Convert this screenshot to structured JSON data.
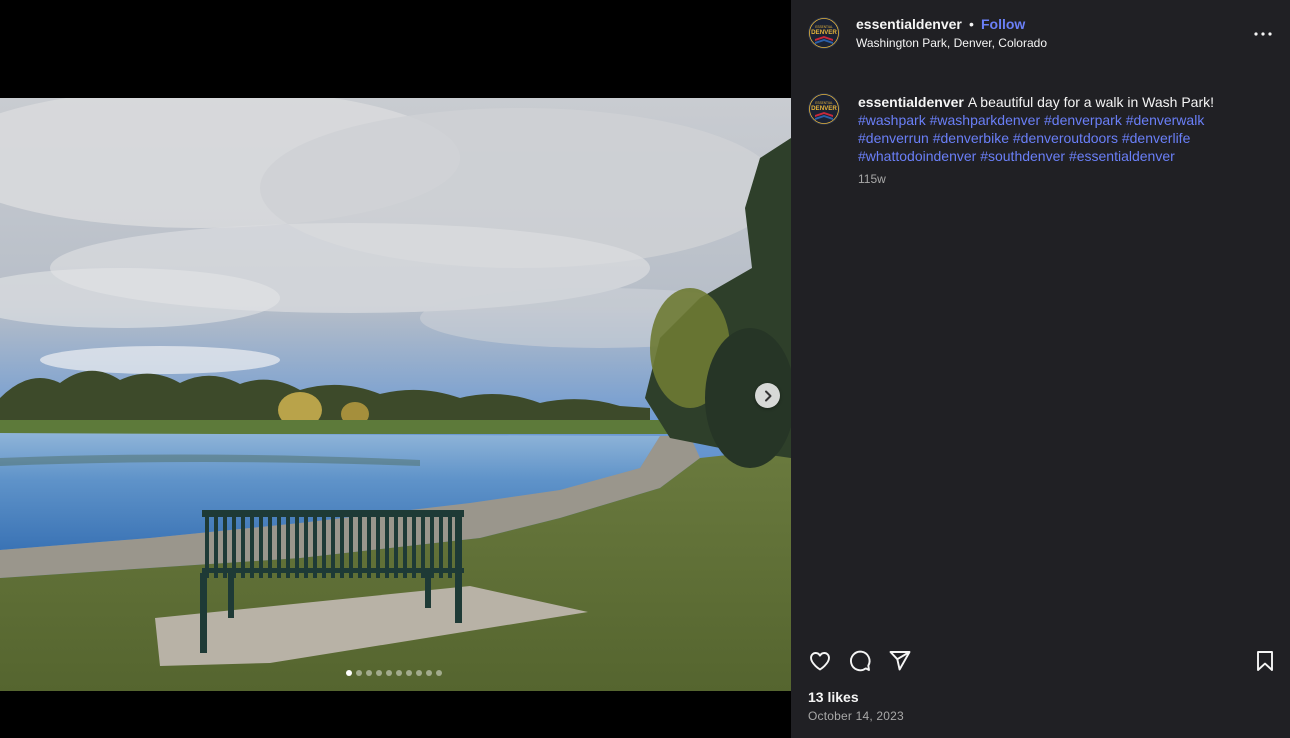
{
  "media": {
    "next_icon": "chevron-right-icon",
    "carousel_count": 10,
    "carousel_active_index": 0
  },
  "header": {
    "username": "essentialdenver",
    "separator": "•",
    "follow_label": "Follow",
    "location": "Washington Park, Denver, Colorado",
    "more_icon": "more-horizontal-icon"
  },
  "avatar": {
    "text_top": "ESSENTIAL",
    "text_main": "DENVER",
    "colors": {
      "ring": "#27324a",
      "gold": "#e6b43a",
      "red": "#c8283a",
      "blue": "#2b5fa8"
    }
  },
  "caption": {
    "username": "essentialdenver",
    "text": "A beautiful day for a walk in Wash Park!",
    "hashtags": [
      "#washpark",
      "#washparkdenver",
      "#denverpark",
      "#denverwalk",
      "#denverrun",
      "#denverbike",
      "#denveroutdoors",
      "#denverlife",
      "#whattodoindenver",
      "#southdenver",
      "#essentialdenver"
    ],
    "time": "115w"
  },
  "actions": {
    "like_icon": "heart-icon",
    "comment_icon": "comment-icon",
    "share_icon": "send-icon",
    "save_icon": "bookmark-icon"
  },
  "likes": "13 likes",
  "date": "October 14, 2023",
  "colors": {
    "panel_bg": "#202024",
    "link": "#6a7ff7",
    "muted": "#a8a8a8"
  }
}
